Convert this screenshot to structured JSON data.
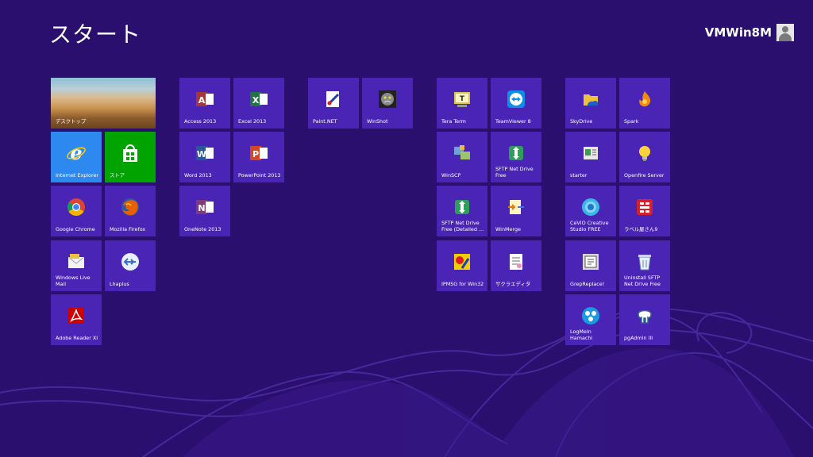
{
  "screen": {
    "title": "スタート",
    "user_name": "VMWin8M"
  },
  "tiles": {
    "desktop": "デスクトップ",
    "ie": "Internet Explorer",
    "store": "ストア",
    "chrome": "Google Chrome",
    "firefox": "Mozilla Firefox",
    "livemail": "Windows Live Mail",
    "lhaplus": "Lhaplus",
    "adobe": "Adobe Reader XI",
    "access": "Access 2013",
    "excel": "Excel 2013",
    "word": "Word 2013",
    "powerpoint": "PowerPoint 2013",
    "onenote": "OneNote 2013",
    "paintnet": "Paint.NET",
    "winshot": "WinShot",
    "teraterm": "Tera Term",
    "teamviewer": "TeamViewer 8",
    "winscp": "WinSCP",
    "sftpfree": "SFTP Net Drive Free",
    "sftpdetailed": "SFTP Net Drive Free (Detailed …",
    "winmerge": "WinMerge",
    "ipmsg": "IPMSG for Win32",
    "sakura": "サクラエディタ",
    "skydrive": "SkyDrive",
    "spark": "Spark",
    "starter": "starter",
    "openfire": "Openfire Server",
    "cevio": "CeVIO Creative Studio FREE",
    "labelya": "ラベル屋さん9",
    "grepreplace": "GrepReplace!",
    "uninstallsftp": "Uninstall SFTP Net Drive Free",
    "logmein": "LogMeIn Hamachi",
    "pgadmin": "pgAdmin III"
  },
  "icons": {
    "ie": "internet-explorer-icon",
    "store": "store-bag-icon",
    "chrome": "chrome-icon",
    "firefox": "firefox-icon",
    "office_access": "access-icon",
    "office_excel": "excel-icon",
    "office_word": "word-icon",
    "office_powerpoint": "powerpoint-icon",
    "office_onenote": "onenote-icon"
  },
  "colors": {
    "background": "#2a0f6e",
    "tile": "#4a25b5",
    "ie_tile": "#2d89ef",
    "store_tile": "#00a300",
    "access": "#a4373a",
    "excel": "#217346",
    "word": "#2b579a",
    "powerpoint": "#d24726",
    "onenote": "#80397b"
  }
}
